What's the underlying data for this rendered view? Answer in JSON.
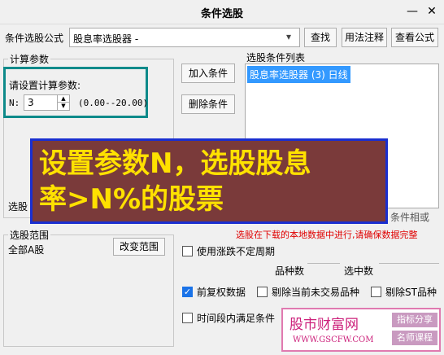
{
  "window": {
    "title": "条件选股",
    "min_glyph": "—",
    "close_glyph": "✕"
  },
  "formula_row": {
    "label": "条件选股公式",
    "selected": "股息率选股器 -",
    "dropdown_glyph": "▾",
    "find_button": "查找",
    "usage_button": "用法注释",
    "view_button": "查看公式"
  },
  "params_group": {
    "legend": "计算参数",
    "prompt": "请设置计算参数:",
    "param_name": "N:",
    "param_value": "3",
    "param_range": "(0.00--20.00)",
    "add_button": "加入条件",
    "delete_button": "删除条件",
    "partial_label": "选股"
  },
  "conditions_list": {
    "label": "选股条件列表",
    "items": [
      "股息率选股器 (3) 日线"
    ],
    "partial_right": "条件相或"
  },
  "overlay": {
    "line1": "设置参数N，选股股息",
    "line2": "率>N%的股票"
  },
  "range_group": {
    "legend": "选股范围",
    "value": "全部A股",
    "change_button": "改变范围"
  },
  "notice": "选股在下载的本地数据中进行,请确保数据完整",
  "options": {
    "use_limit_label": "使用涨跌不定周期",
    "variety_count_label": "品种数",
    "selected_count_label": "选中数",
    "forward_adjust_label": "前复权数据",
    "forward_adjust_checked": true,
    "exclude_untraded_label": "剔除当前未交易品种",
    "exclude_st_label": "剔除ST品种",
    "time_range_label": "时间段内满足条件"
  },
  "watermark": {
    "name": "股市财富网",
    "url": "WWW.GSCFW.COM",
    "tag1": "指标分享",
    "tag2": "名师课程"
  }
}
